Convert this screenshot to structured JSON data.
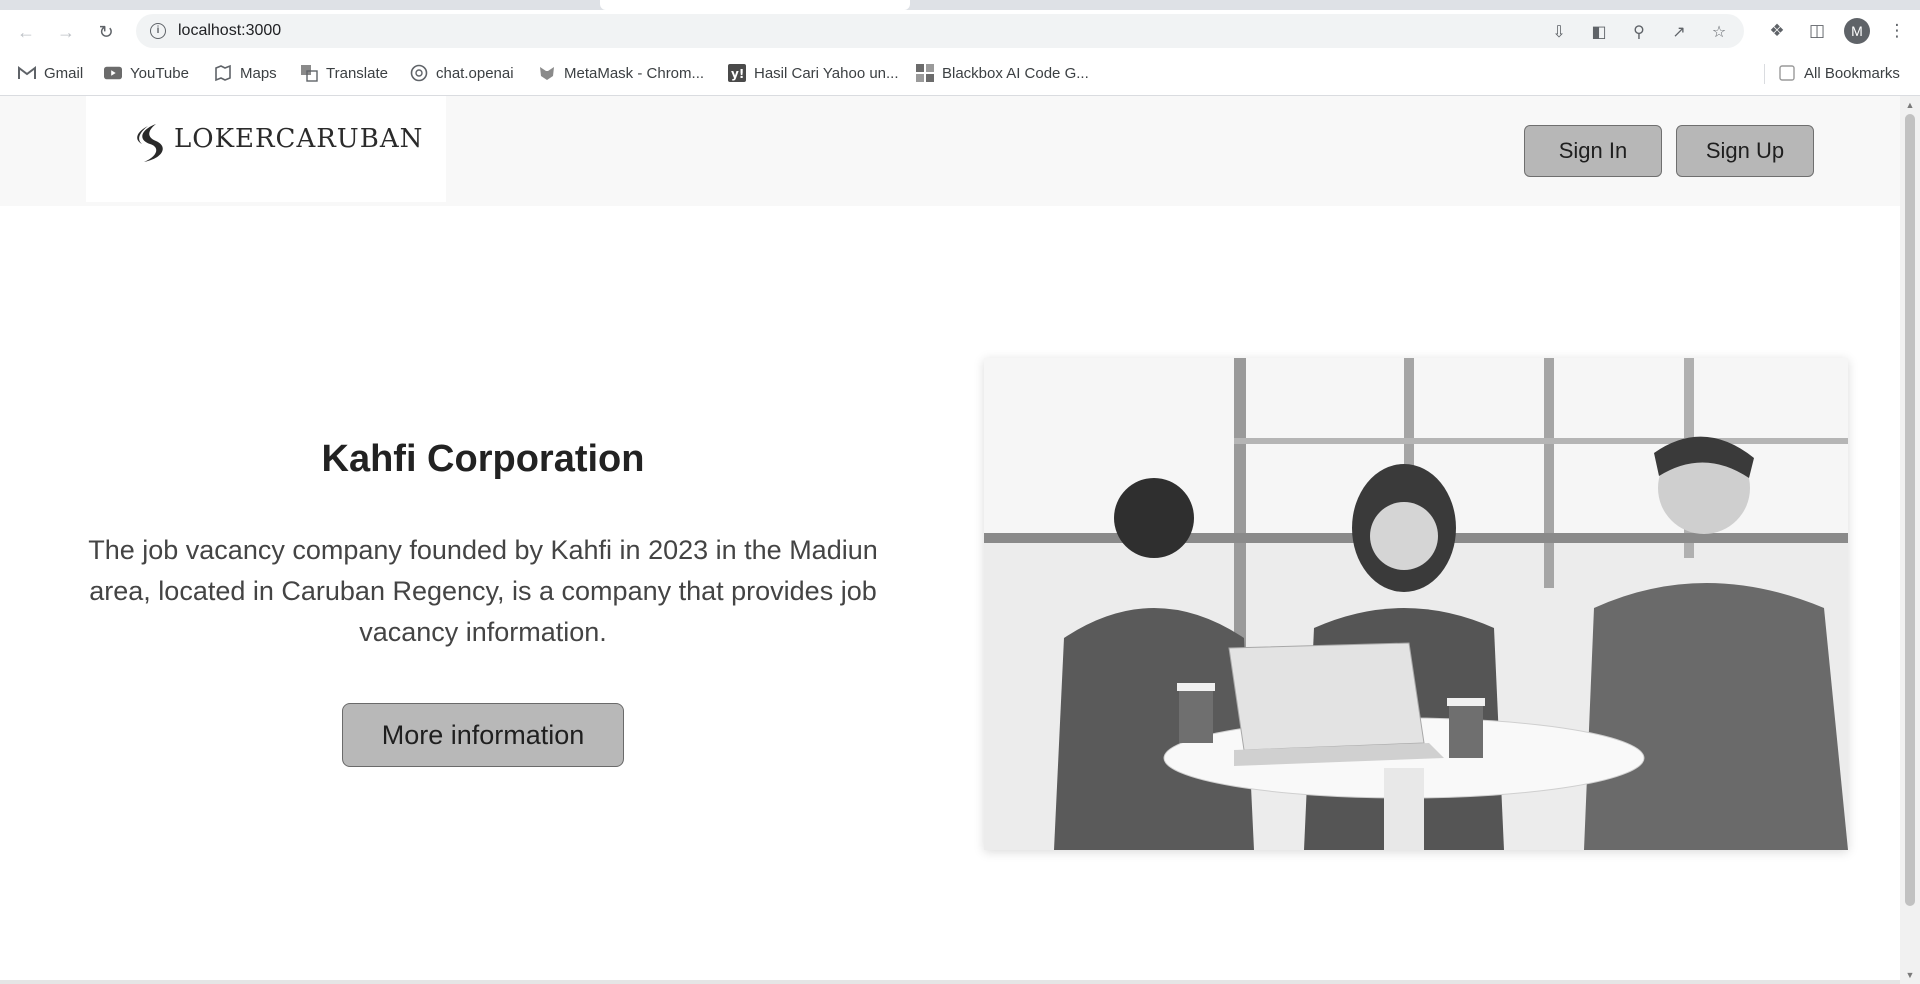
{
  "browser": {
    "url": "localhost:3000",
    "profile_initial": "M",
    "bookmarks": [
      {
        "label": "Gmail",
        "icon": "gmail-icon"
      },
      {
        "label": "YouTube",
        "icon": "youtube-icon"
      },
      {
        "label": "Maps",
        "icon": "maps-icon"
      },
      {
        "label": "Translate",
        "icon": "translate-icon"
      },
      {
        "label": "chat.openai",
        "icon": "openai-icon"
      },
      {
        "label": "MetaMask - Chrom...",
        "icon": "metamask-icon"
      },
      {
        "label": "Hasil Cari Yahoo un...",
        "icon": "yahoo-icon"
      },
      {
        "label": "Blackbox AI Code G...",
        "icon": "blackbox-icon"
      }
    ],
    "all_bookmarks_label": "All Bookmarks"
  },
  "header": {
    "logo_text": "LOKERCARUBAN",
    "sign_in_label": "Sign In",
    "sign_up_label": "Sign Up"
  },
  "hero": {
    "title": "Kahfi Corporation",
    "description": "The job vacancy company founded by Kahfi in 2023 in the Madiun area, located in Caruban Regency, is a company that provides job vacancy information.",
    "button_label": "More information"
  },
  "colors": {
    "header_bg": "#f8f8f8",
    "button_bg": "#b8b8b8",
    "button_border": "#6a6a6a"
  }
}
